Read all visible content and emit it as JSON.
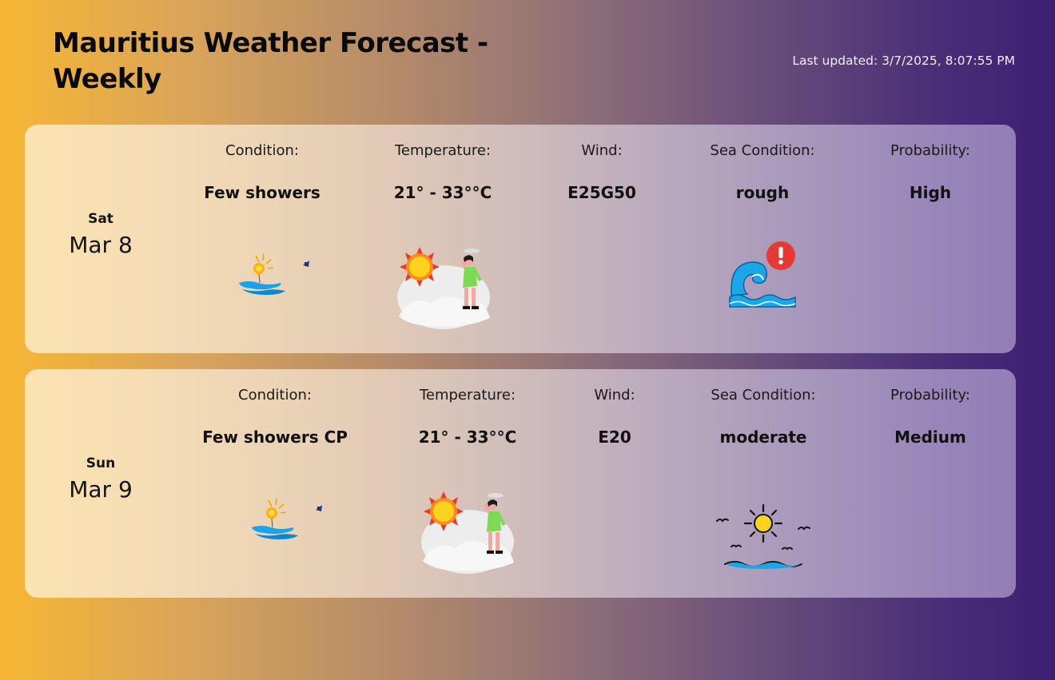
{
  "header": {
    "title": "Mauritius Weather Forecast - Weekly",
    "last_updated": "Last updated: 3/7/2025, 8:07:55 PM"
  },
  "labels": {
    "condition": "Condition:",
    "temperature": "Temperature:",
    "wind": "Wind:",
    "sea": "Sea Condition:",
    "probability": "Probability:"
  },
  "days": [
    {
      "day": "Sat",
      "date": "Mar 8",
      "condition": "Few showers",
      "temperature": "21° - 33°°C",
      "wind": "E25G50",
      "sea": "rough",
      "probability": "High",
      "sea_icon": "rough-sea-warning-icon"
    },
    {
      "day": "Sun",
      "date": "Mar 9",
      "condition": "Few showers CP",
      "temperature": "21° - 33°°C",
      "wind": "E20",
      "sea": "moderate",
      "probability": "Medium",
      "sea_icon": "calm-sea-sun-icon"
    }
  ],
  "colors": {
    "gradient_left": "#f7b733",
    "gradient_right": "#3d1f72",
    "sun": "#ffcc00",
    "water": "#1aa3e8"
  }
}
